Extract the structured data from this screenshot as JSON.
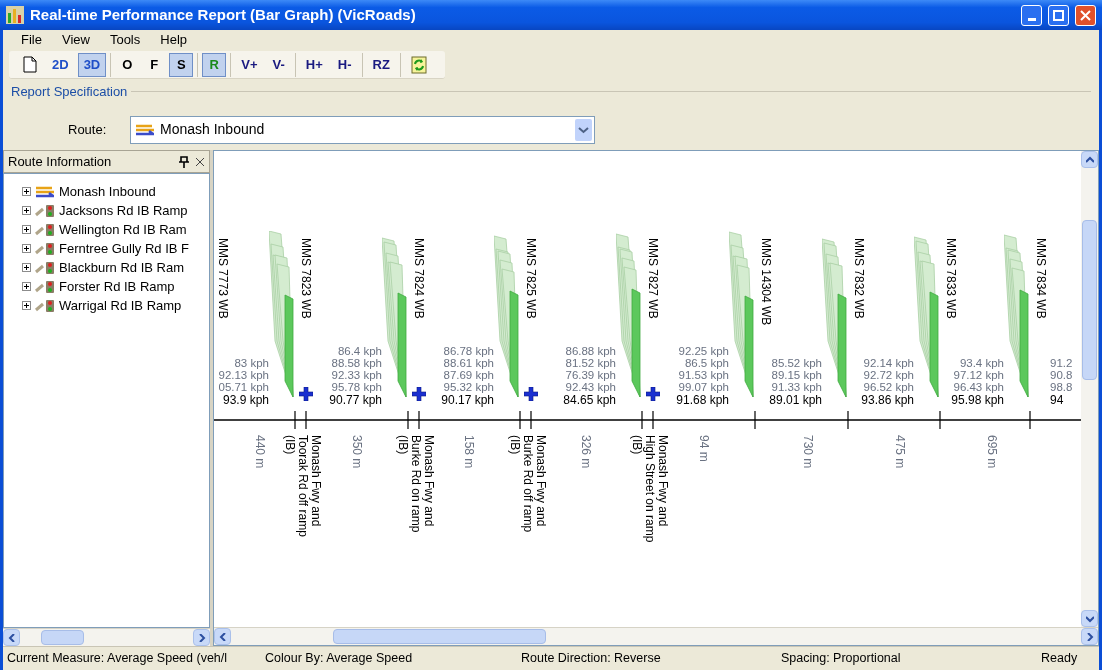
{
  "window": {
    "title": "Real-time Performance Report (Bar Graph) (VicRoads)"
  },
  "menu": [
    "File",
    "View",
    "Tools",
    "Help"
  ],
  "toolbar": [
    [
      {
        "kind": "new",
        "selected": false
      },
      {
        "kind": "label",
        "label": "2D",
        "color": "#1f4fc8",
        "selected": false
      },
      {
        "kind": "label",
        "label": "3D",
        "color": "#1f4fc8",
        "selected": true
      }
    ],
    [
      {
        "kind": "label",
        "label": "O",
        "color": "#000000",
        "selected": false
      },
      {
        "kind": "label",
        "label": "F",
        "color": "#000000",
        "selected": false
      },
      {
        "kind": "label",
        "label": "S",
        "color": "#000000",
        "selected": true
      }
    ],
    [
      {
        "kind": "label",
        "label": "R",
        "color": "#1a8a1a",
        "selected": true
      }
    ],
    [
      {
        "kind": "label",
        "label": "V+",
        "color": "#1a1a80",
        "selected": false
      },
      {
        "kind": "label",
        "label": "V-",
        "color": "#1a1a80",
        "selected": false
      }
    ],
    [
      {
        "kind": "label",
        "label": "H+",
        "color": "#1a1a80",
        "selected": false
      },
      {
        "kind": "label",
        "label": "H-",
        "color": "#1a1a80",
        "selected": false
      }
    ],
    [
      {
        "kind": "label",
        "label": "RZ",
        "color": "#1a1a80",
        "selected": false
      }
    ],
    [
      {
        "kind": "refresh",
        "selected": false
      }
    ]
  ],
  "report_specification": {
    "title": "Report Specification",
    "route_label": "Route:",
    "route_value": "Monash Inbound"
  },
  "route_information": {
    "title": "Route Information",
    "items": [
      {
        "kind": "route",
        "label": "Monash Inbound",
        "expanded": false
      },
      {
        "kind": "ramp",
        "label": "Jacksons Rd IB Ramp",
        "expanded": false
      },
      {
        "kind": "ramp",
        "label": "Wellington Rd IB Ram",
        "expanded": false
      },
      {
        "kind": "ramp",
        "label": "Ferntree Gully Rd IB F",
        "expanded": false
      },
      {
        "kind": "ramp",
        "label": "Blackburn Rd IB Ram",
        "expanded": false
      },
      {
        "kind": "ramp",
        "label": "Forster Rd IB Ramp",
        "expanded": false
      },
      {
        "kind": "ramp",
        "label": "Warrigal Rd IB Ramp",
        "expanded": false
      }
    ]
  },
  "chart": {
    "stations": [
      {
        "label": "MMS 7773 WB",
        "readings": [
          "83 kph",
          "92.13 kph",
          "05.71 kph"
        ],
        "current": "93.9 kph",
        "distance": "440 m"
      },
      {
        "label": "MMS 7823 WB",
        "readings": [
          "86.4 kph",
          "88.58 kph",
          "92.33 kph",
          "95.78 kph"
        ],
        "current": "90.77 kph",
        "distance": "350 m",
        "junction": {
          "label": "Monash Fwy and Toorak Rd off ramp (IB)"
        }
      },
      {
        "label": "MMS 7824 WB",
        "readings": [
          "86.78 kph",
          "88.61 kph",
          "87.69 kph",
          "95.32 kph"
        ],
        "current": "90.17 kph",
        "distance": "158 m",
        "junction": {
          "label": "Monash Fwy and Burke Rd on ramp (IB)"
        }
      },
      {
        "label": "MMS 7825 WB",
        "readings": [
          "86.88 kph",
          "81.52 kph",
          "76.39 kph",
          "92.43 kph"
        ],
        "current": "84.65 kph",
        "distance": "326 m",
        "junction": {
          "label": "Monash Fwy and Burke Rd off ramp (IB)"
        }
      },
      {
        "label": "MMS 7827 WB",
        "readings": [
          "92.25 kph",
          "86.5 kph",
          "91.53 kph",
          "99.07 kph"
        ],
        "current": "91.68 kph",
        "distance": "94 m",
        "junction": {
          "label": "Monash Fwy and High Street on ramp (IB)"
        }
      },
      {
        "label": "MMS 14304 WB",
        "readings": [
          "85.52 kph",
          "89.15 kph",
          "91.33 kph"
        ],
        "current": "89.01 kph",
        "distance": "730 m"
      },
      {
        "label": "MMS 7832 WB",
        "readings": [
          "92.14 kph",
          "92.72 kph",
          "96.52 kph"
        ],
        "current": "93.86 kph",
        "distance": "475 m"
      },
      {
        "label": "MMS 7833 WB",
        "readings": [
          "93.4 kph",
          "97.12 kph",
          "96.43 kph"
        ],
        "current": "95.98 kph",
        "distance": "695 m"
      },
      {
        "label": "MMS 7834 WB",
        "readings": [
          "91.2",
          "90.8",
          "98.8"
        ],
        "current": "94"
      }
    ]
  },
  "status_bar": [
    "Current Measure: Average Speed (veh/l",
    "Colour By: Average Speed",
    "Route Direction: Reverse",
    "Spacing: Proportional",
    "Ready"
  ]
}
